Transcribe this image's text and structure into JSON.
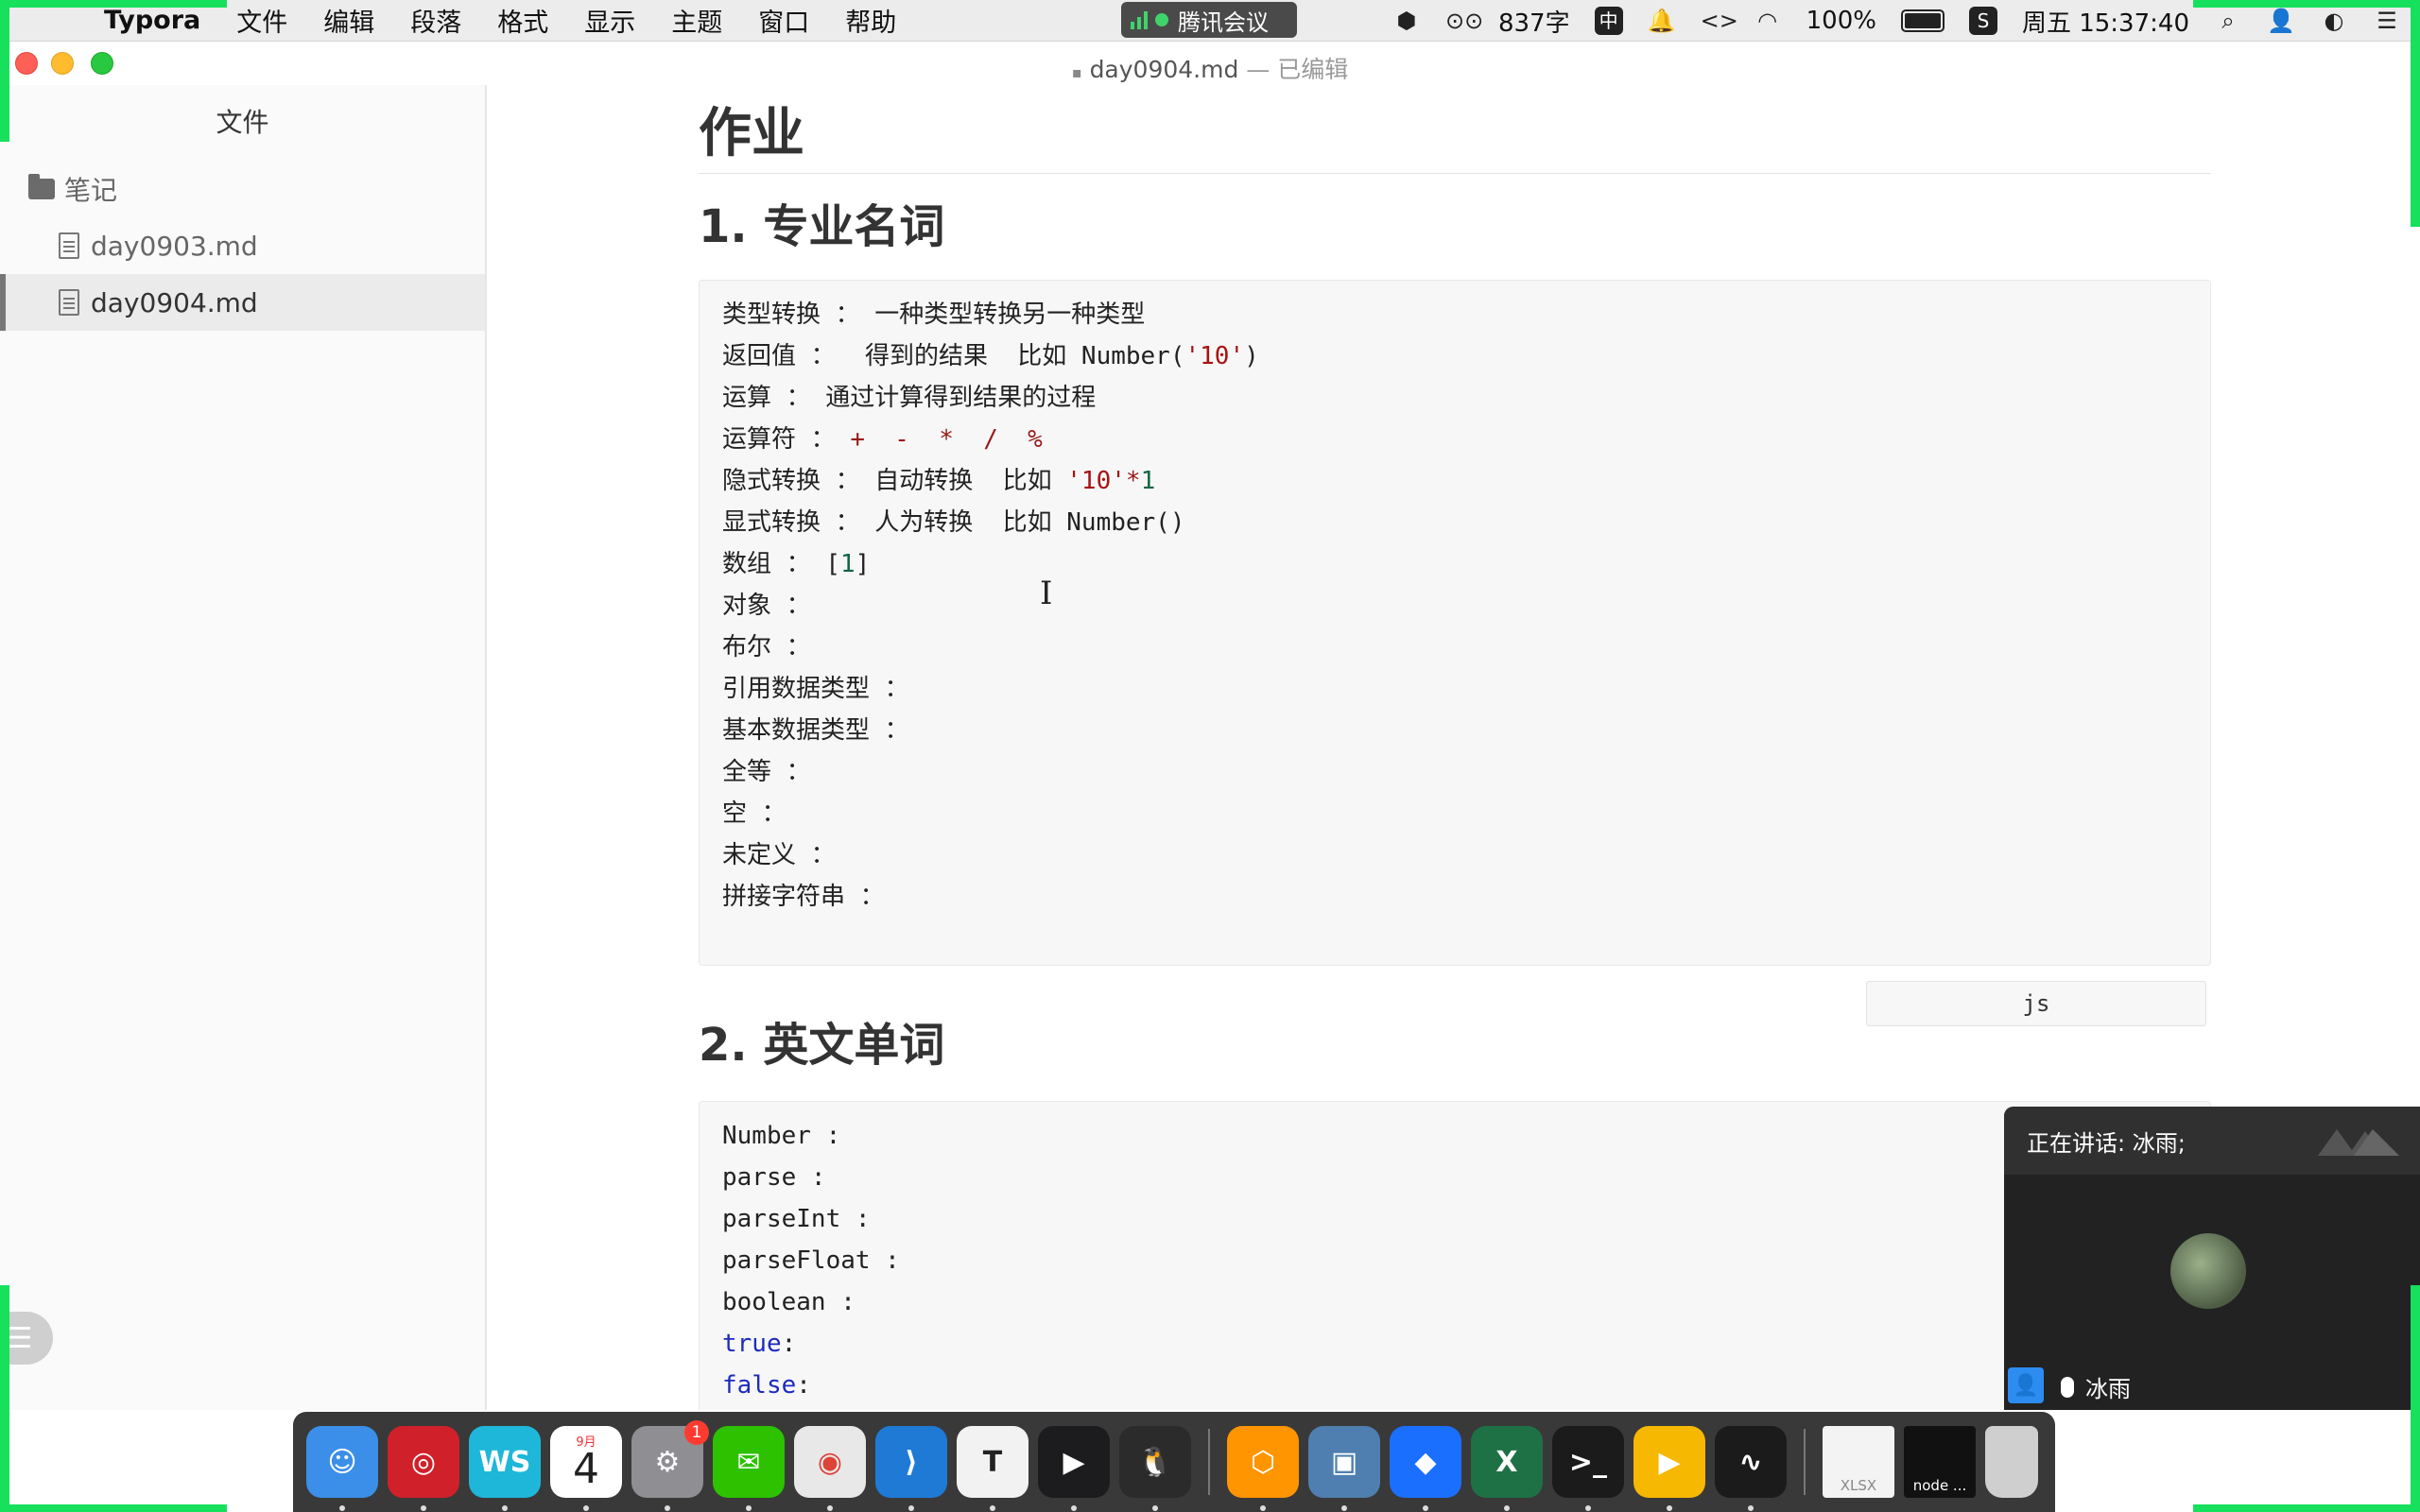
{
  "menubar": {
    "apple": "",
    "app_name": "Typora",
    "items": [
      "文件",
      "编辑",
      "段落",
      "格式",
      "显示",
      "主题",
      "窗口",
      "帮助"
    ],
    "meeting_pill": "腾讯会议",
    "word_count": "837字",
    "input_method": "中",
    "battery": "100%",
    "clock": "周五 15:37:40"
  },
  "window": {
    "filename": "day0904.md",
    "separator": " — ",
    "status": "已编辑"
  },
  "sidebar": {
    "title": "文件",
    "folder": "笔记",
    "files": [
      "day0903.md",
      "day0904.md"
    ],
    "active_file": "day0904.md"
  },
  "document": {
    "h1": "作业",
    "section1_title": "1. 专业名词",
    "section2_title": "2. 英文单词",
    "code1_language": "js",
    "code1_lines": [
      [
        {
          "t": "类型转换 ： 一种类型转换另一种类型",
          "c": "plain"
        }
      ],
      [
        {
          "t": "返回值 ：  得到的结果  比如 Number(",
          "c": "plain"
        },
        {
          "t": "'10'",
          "c": "str"
        },
        {
          "t": ")",
          "c": "plain"
        }
      ],
      [
        {
          "t": "运算 ： 通过计算得到结果的过程",
          "c": "plain"
        }
      ],
      [
        {
          "t": "运算符 ： ",
          "c": "plain"
        },
        {
          "t": "+  -  *  /  %",
          "c": "op"
        }
      ],
      [
        {
          "t": "隐式转换 ： 自动转换  比如 ",
          "c": "plain"
        },
        {
          "t": "'10'",
          "c": "str"
        },
        {
          "t": "*",
          "c": "op"
        },
        {
          "t": "1",
          "c": "num"
        }
      ],
      [
        {
          "t": "显式转换 ： 人为转换  比如 Number()",
          "c": "plain"
        }
      ],
      [
        {
          "t": "数组 ： ",
          "c": "plain"
        },
        {
          "t": "[",
          "c": "plain"
        },
        {
          "t": "1",
          "c": "num"
        },
        {
          "t": "]",
          "c": "plain"
        }
      ],
      [
        {
          "t": "对象 ：",
          "c": "plain"
        }
      ],
      [
        {
          "t": "布尔 ：",
          "c": "plain"
        }
      ],
      [
        {
          "t": "引用数据类型 ：",
          "c": "plain"
        }
      ],
      [
        {
          "t": "基本数据类型 ：",
          "c": "plain"
        }
      ],
      [
        {
          "t": "全等 ：",
          "c": "plain"
        }
      ],
      [
        {
          "t": "空 ：",
          "c": "plain"
        }
      ],
      [
        {
          "t": "未定义 ：",
          "c": "plain"
        }
      ],
      [
        {
          "t": "拼接字符串 ：",
          "c": "plain"
        }
      ],
      [
        {
          "t": "",
          "c": "plain"
        }
      ]
    ],
    "code2_lines": [
      [
        {
          "t": "Number :",
          "c": "plain"
        }
      ],
      [
        {
          "t": "parse :",
          "c": "plain"
        }
      ],
      [
        {
          "t": "parseInt :",
          "c": "plain"
        }
      ],
      [
        {
          "t": "parseFloat :",
          "c": "plain"
        }
      ],
      [
        {
          "t": "boolean :",
          "c": "plain"
        }
      ],
      [
        {
          "t": "true",
          "c": "kw"
        },
        {
          "t": ":",
          "c": "plain"
        }
      ],
      [
        {
          "t": "false",
          "c": "kw"
        },
        {
          "t": ":",
          "c": "plain"
        }
      ]
    ]
  },
  "meeting_window": {
    "speaking_label": "正在讲话: 冰雨;",
    "participant_name": "冰雨"
  },
  "dock": {
    "apps": [
      {
        "name": "finder",
        "color": "#3b8fe8",
        "glyph": "☺"
      },
      {
        "name": "netease-music",
        "color": "#d0202a",
        "glyph": "◎"
      },
      {
        "name": "webstorm",
        "color": "#1fb7d9",
        "glyph": "WS"
      },
      {
        "name": "calendar",
        "color": "#ffffff",
        "glyph": "4",
        "month": "9月"
      },
      {
        "name": "system-preferences",
        "color": "#8e8e93",
        "glyph": "⚙",
        "badge": "1"
      },
      {
        "name": "wechat",
        "color": "#2dc100",
        "glyph": "✉"
      },
      {
        "name": "chrome",
        "color": "#e8e8e8",
        "glyph": "◉"
      },
      {
        "name": "vscode",
        "color": "#1f7ad6",
        "glyph": "⟩"
      },
      {
        "name": "typora",
        "color": "#f2f2f2",
        "glyph": "T"
      },
      {
        "name": "quicktime",
        "color": "#1c1c1e",
        "glyph": "▶"
      },
      {
        "name": "qq",
        "color": "#2b2b2b",
        "glyph": "🐧"
      },
      {
        "name": "tencent-meeting-shield",
        "color": "#ff9500",
        "glyph": "⬡"
      },
      {
        "name": "preview",
        "color": "#4f7fb0",
        "glyph": "▣"
      },
      {
        "name": "tencent-meeting",
        "color": "#1b6fff",
        "glyph": "◆"
      },
      {
        "name": "excel",
        "color": "#1e7145",
        "glyph": "X"
      },
      {
        "name": "terminal",
        "color": "#1b1b1b",
        "glyph": ">_"
      },
      {
        "name": "keynote-player",
        "color": "#f6b800",
        "glyph": "▶"
      },
      {
        "name": "activity-monitor",
        "color": "#1b1b1b",
        "glyph": "∿"
      }
    ],
    "docs": [
      {
        "name": "xlsx-file",
        "label": "XLSX"
      },
      {
        "name": "node-terminal",
        "label": "node ..."
      },
      {
        "name": "trash",
        "label": ""
      }
    ]
  }
}
